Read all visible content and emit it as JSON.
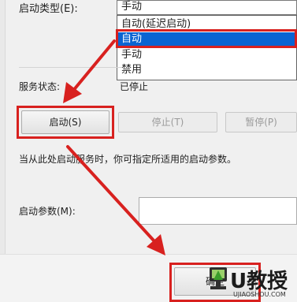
{
  "startup": {
    "type_label": "启动类型(E):",
    "current_value": "手动",
    "options": [
      "自动(延迟启动)",
      "自动",
      "手动",
      "禁用"
    ],
    "selected_index": 1
  },
  "status": {
    "label": "服务状态:",
    "value": "已停止"
  },
  "buttons": {
    "start": "启动(S)",
    "stop": "停止(T)",
    "pause": "暂停(P)"
  },
  "hint": "当从此处启动服务时，你可指定所适用的启动参数。",
  "params": {
    "label": "启动参数(M):",
    "value": ""
  },
  "footer": {
    "ok_label": "确定"
  },
  "watermark": {
    "brand": "U教授",
    "url": "UJIAOSHOU.COM"
  },
  "colors": {
    "highlight": "#d8211f",
    "selection": "#0a64d2"
  }
}
